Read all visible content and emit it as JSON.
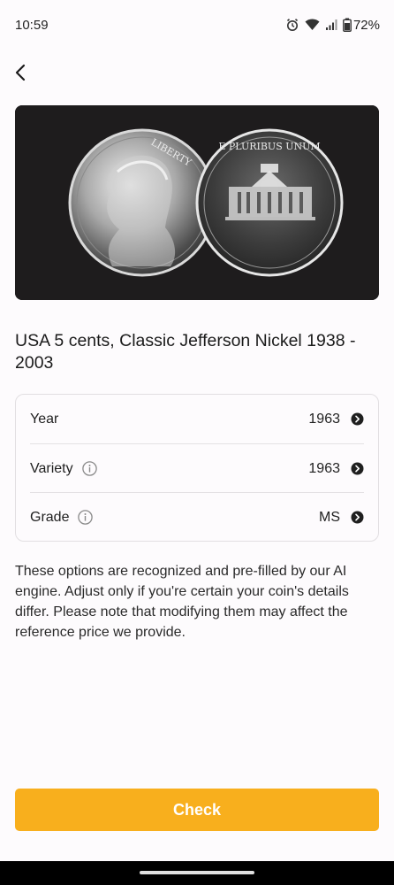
{
  "status_bar": {
    "time": "10:59",
    "battery": "72%",
    "icons": [
      "alarm-icon",
      "wifi-icon",
      "signal-icon",
      "battery-icon"
    ]
  },
  "nav": {
    "back_icon": "chevron-left-icon"
  },
  "coin_image": {
    "legend_obverse": "LIBERTY",
    "legend_reverse": "E PLURIBUS UNUM"
  },
  "title": "USA 5 cents, Classic Jefferson Nickel 1938 - 2003",
  "options": [
    {
      "label": "Year",
      "value": "1963",
      "has_info": false
    },
    {
      "label": "Variety",
      "value": "1963",
      "has_info": true
    },
    {
      "label": "Grade",
      "value": "MS",
      "has_info": true
    }
  ],
  "description": "These options are recognized and pre-filled by our AI engine. Adjust only if you're certain your coin's details differ. Please note that modifying them may affect the reference price we provide.",
  "check_button": {
    "label": "Check",
    "color": "#f8af1d"
  }
}
